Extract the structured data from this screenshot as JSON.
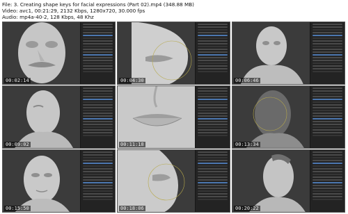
{
  "header": {
    "line1": "File: 3. Creating shape keys for facial expressions (Part 02).mp4 (348.88 MB)",
    "line2": "Video: avc1, 00:21:29, 2132 Kbps, 1280x720, 30.000 fps",
    "line3": "Audio: mp4a-40-2, 128 Kbps, 48 Khz"
  },
  "thumbnails": [
    {
      "time": "00:02:14",
      "view": "face-front-mustache"
    },
    {
      "time": "00:04:30",
      "view": "mouth-closeup-side"
    },
    {
      "time": "00:06:46",
      "view": "head-torso-front"
    },
    {
      "time": "00:09:02",
      "view": "head-three-quarter"
    },
    {
      "time": "00:11:18",
      "view": "lips-closeup"
    },
    {
      "time": "00:13:34",
      "view": "head-dark-three-quarter"
    },
    {
      "time": "00:15:50",
      "view": "face-front"
    },
    {
      "time": "00:18:06",
      "view": "chin-closeup-side"
    },
    {
      "time": "00:20:22",
      "view": "head-mohawk-side"
    }
  ],
  "colors": {
    "viewport": "#3b3b3b",
    "panel": "#232323",
    "model": "#c9c9c9",
    "accent": "#4c77b0"
  }
}
